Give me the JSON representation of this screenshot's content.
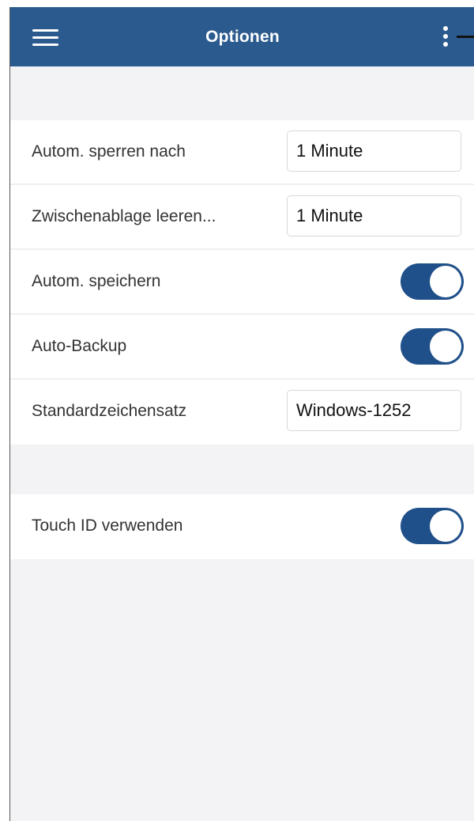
{
  "header": {
    "title": "Optionen",
    "menu_icon": "hamburger-icon",
    "more_icon": "more-vertical-icon",
    "bar_color": "#2b5b8e"
  },
  "settings": {
    "lock_after": {
      "label": "Autom. sperren nach",
      "value": "1 Minute"
    },
    "clear_clipboard": {
      "label": "Zwischenablage leeren...",
      "value": "1 Minute"
    },
    "auto_save": {
      "label": "Autom. speichern",
      "enabled": true
    },
    "auto_backup": {
      "label": "Auto-Backup",
      "enabled": true
    },
    "default_charset": {
      "label": "Standardzeichensatz",
      "value": "Windows-1252"
    }
  },
  "security": {
    "touch_id": {
      "label": "Touch ID verwenden",
      "enabled": true
    }
  },
  "colors": {
    "toggle_on": "#20508a",
    "background": "#f3f3f5"
  }
}
